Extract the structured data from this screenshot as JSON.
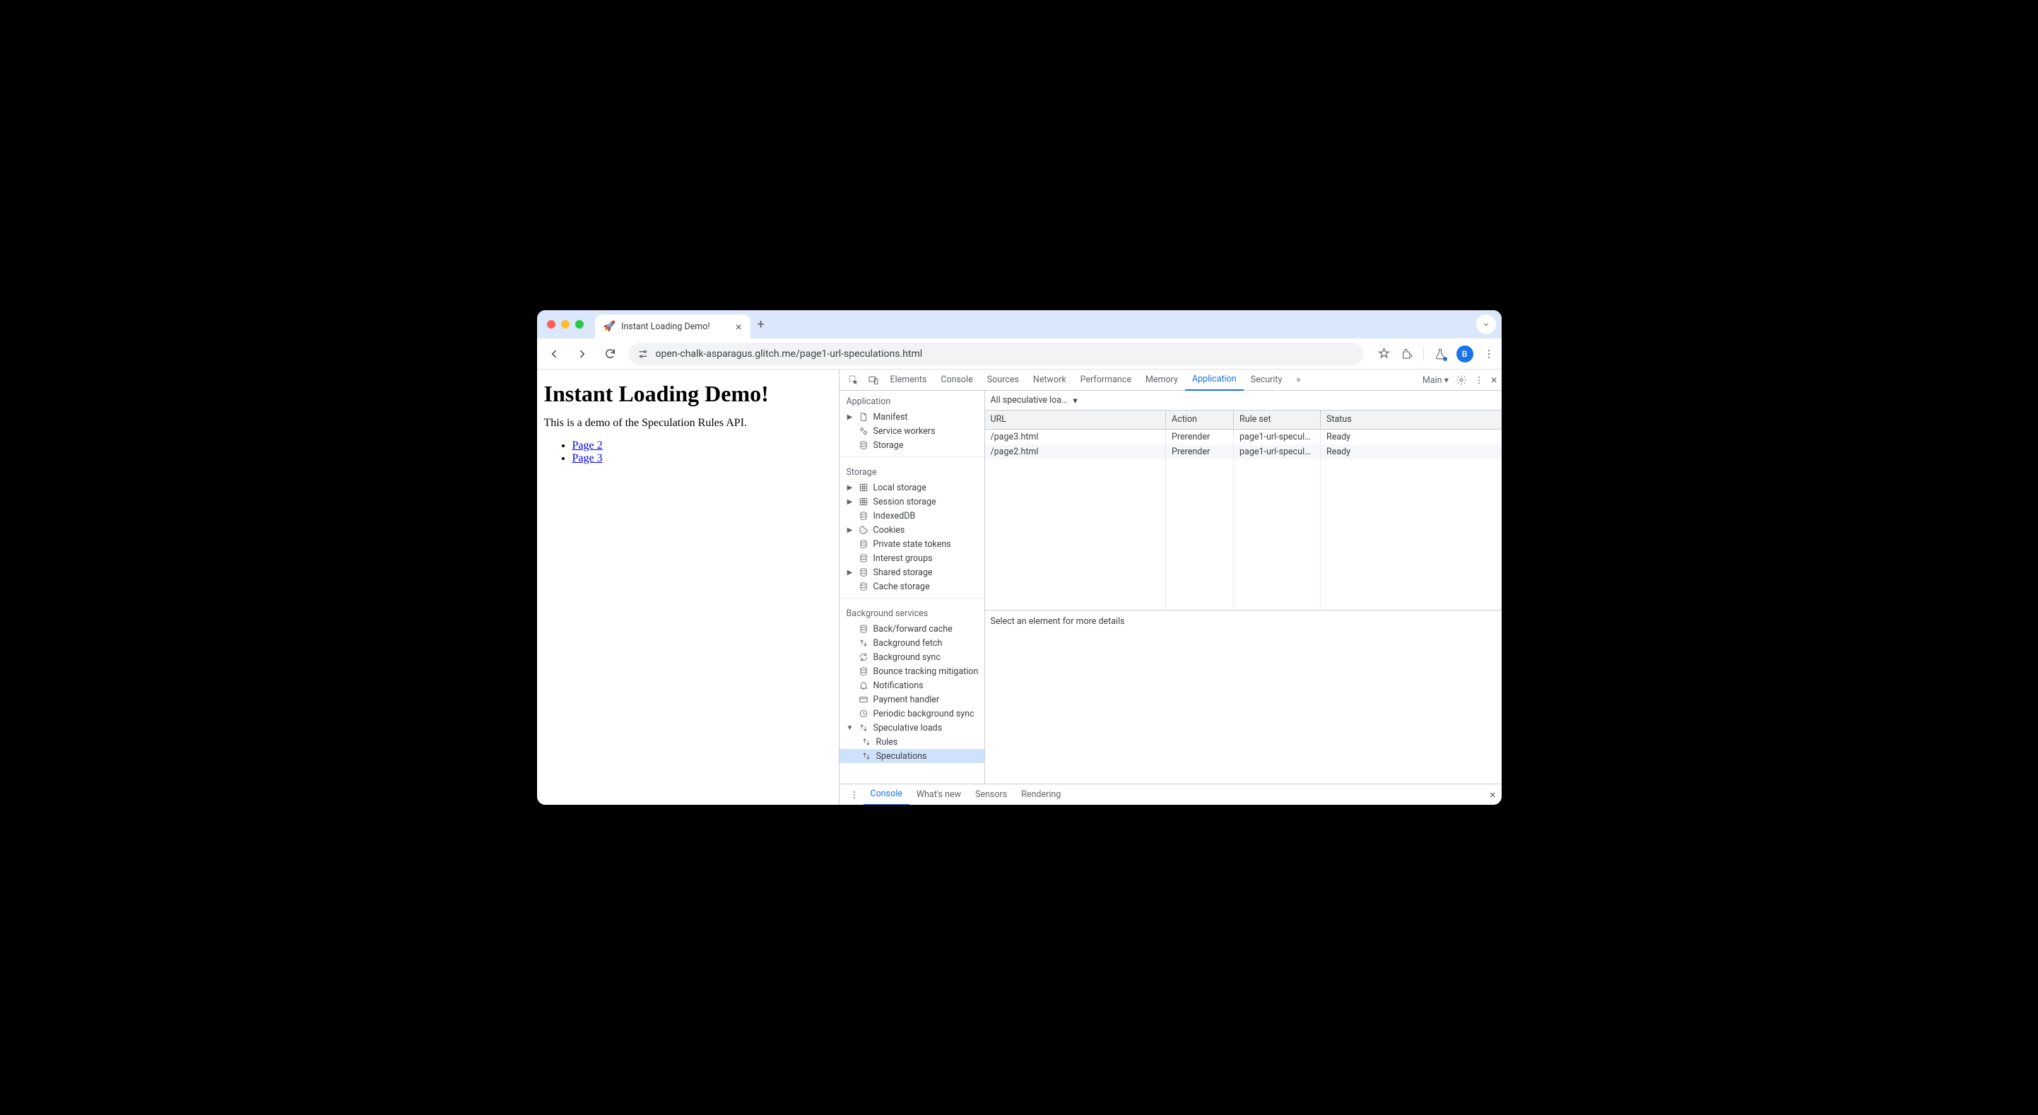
{
  "browser": {
    "tab": {
      "favicon": "🚀",
      "title": "Instant Loading Demo!"
    },
    "url": "open-chalk-asparagus.glitch.me/page1-url-speculations.html",
    "avatar_letter": "B"
  },
  "page": {
    "heading": "Instant Loading Demo!",
    "intro": "This is a demo of the Speculation Rules API.",
    "links": [
      {
        "label": "Page 2"
      },
      {
        "label": "Page 3"
      }
    ]
  },
  "devtools": {
    "tabs": [
      "Elements",
      "Console",
      "Sources",
      "Network",
      "Performance",
      "Memory",
      "Application",
      "Security"
    ],
    "active_tab": "Application",
    "more": "»",
    "target": "Main ▾",
    "sidebar": {
      "application": {
        "label": "Application",
        "items": [
          {
            "label": "Manifest",
            "icon": "file",
            "arrow": true
          },
          {
            "label": "Service workers",
            "icon": "gears"
          },
          {
            "label": "Storage",
            "icon": "db"
          }
        ]
      },
      "storage": {
        "label": "Storage",
        "items": [
          {
            "label": "Local storage",
            "icon": "grid",
            "arrow": true
          },
          {
            "label": "Session storage",
            "icon": "grid",
            "arrow": true
          },
          {
            "label": "IndexedDB",
            "icon": "db"
          },
          {
            "label": "Cookies",
            "icon": "cookie",
            "arrow": true
          },
          {
            "label": "Private state tokens",
            "icon": "db"
          },
          {
            "label": "Interest groups",
            "icon": "db"
          },
          {
            "label": "Shared storage",
            "icon": "db",
            "arrow": true
          },
          {
            "label": "Cache storage",
            "icon": "db"
          }
        ]
      },
      "bgservices": {
        "label": "Background services",
        "items": [
          {
            "label": "Back/forward cache",
            "icon": "db"
          },
          {
            "label": "Background fetch",
            "icon": "updown"
          },
          {
            "label": "Background sync",
            "icon": "sync"
          },
          {
            "label": "Bounce tracking mitigation",
            "icon": "db"
          },
          {
            "label": "Notifications",
            "icon": "bell"
          },
          {
            "label": "Payment handler",
            "icon": "card"
          },
          {
            "label": "Periodic background sync",
            "icon": "clock"
          },
          {
            "label": "Speculative loads",
            "icon": "updown",
            "arrow": true,
            "open": true,
            "children": [
              {
                "label": "Rules",
                "icon": "updown"
              },
              {
                "label": "Speculations",
                "icon": "updown",
                "selected": true
              }
            ]
          }
        ]
      }
    },
    "filter": "All speculative loa…",
    "table": {
      "headers": [
        "URL",
        "Action",
        "Rule set",
        "Status"
      ],
      "rows": [
        {
          "url": "/page3.html",
          "action": "Prerender",
          "ruleset": "page1-url-specul…",
          "status": "Ready"
        },
        {
          "url": "/page2.html",
          "action": "Prerender",
          "ruleset": "page1-url-specul…",
          "status": "Ready"
        }
      ]
    },
    "detail_hint": "Select an element for more details",
    "drawer": {
      "tabs": [
        "Console",
        "What's new",
        "Sensors",
        "Rendering"
      ],
      "active": "Console"
    }
  }
}
